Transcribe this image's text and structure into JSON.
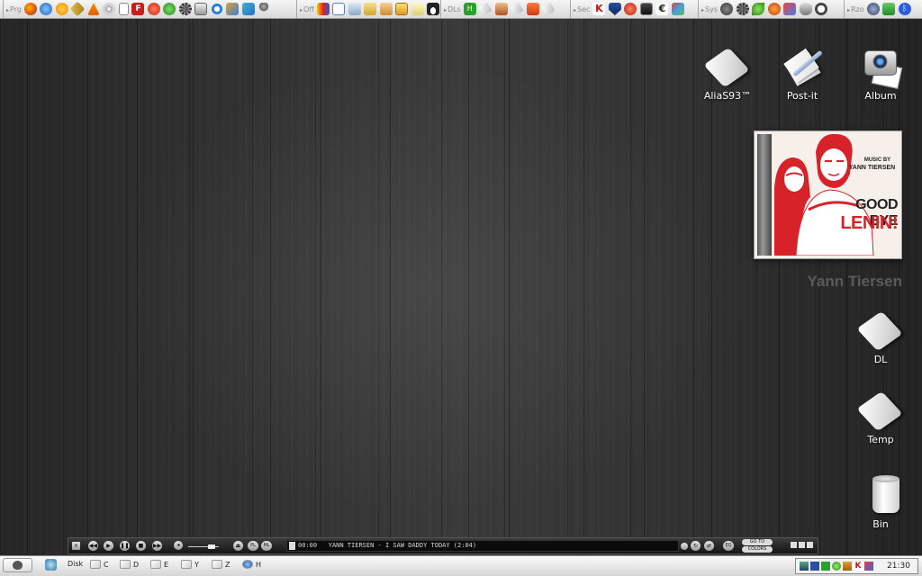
{
  "toolbar": {
    "groups": [
      {
        "label": "Prg",
        "icons": [
          "firefox-icon",
          "globe-icon",
          "media-player-icon",
          "ftp-icon",
          "vlc-icon",
          "disc-icon",
          "document-icon",
          "filezilla-icon",
          "red-app-icon",
          "green-plus-icon",
          "gear-icon",
          "calculator-icon",
          "refresh-icon",
          "network-icon",
          "puzzle-icon",
          "pin-icon"
        ]
      },
      {
        "label": "Off",
        "icons": [
          "colors-icon",
          "edit-icon",
          "document-icon",
          "folder-icon",
          "folder-icon",
          "photo-icon",
          "note-icon",
          "tux-icon"
        ]
      },
      {
        "label": "DLs",
        "icons": [
          "download-icon",
          "tile-icon",
          "pdf-icon",
          "tile-icon",
          "acrobat-icon",
          "tile-icon"
        ]
      },
      {
        "label": "Sec",
        "icons": [
          "k-icon",
          "shield-icon",
          "lock-icon",
          "vault-icon",
          "euro-icon",
          "vpn-shield-icon"
        ]
      },
      {
        "label": "Sys",
        "icons": [
          "wrench-icon",
          "gear-icon",
          "leaf-icon",
          "cpu-icon",
          "tools-icon",
          "drive-icon",
          "clock-icon"
        ]
      },
      {
        "label": "Rzo",
        "icons": [
          "network-icon",
          "antenna-icon",
          "bluetooth-icon"
        ]
      }
    ]
  },
  "desktop": {
    "icons": [
      {
        "label": "AliaS93™",
        "icon": "drive-tile-icon"
      },
      {
        "label": "Post-it",
        "icon": "notes-pen-icon"
      },
      {
        "label": "Album",
        "icon": "camera-photos-icon"
      },
      {
        "label": "DL",
        "icon": "drive-tile-icon"
      },
      {
        "label": "Temp",
        "icon": "drive-tile-icon"
      },
      {
        "label": "Bin",
        "icon": "trash-bin-icon"
      }
    ]
  },
  "now_playing": {
    "artist": "Yann Tiersen",
    "cover": {
      "line1": "MUSIC BY",
      "line2": "YANN TIERSEN",
      "title1": "GOOD BYE",
      "title2": "LENIN!"
    }
  },
  "player": {
    "time": "00:00",
    "track": "YANN TIERSEN - I SAW DADDY TODAY (2:04)",
    "pl_label": "PL",
    "ml_label": "ML",
    "eq_label": "EQ",
    "buttons_label_1": "GO TO",
    "buttons_label_2": "COLORS"
  },
  "taskbar": {
    "disk_label": "Disk",
    "drives": [
      "C",
      "D",
      "E",
      "Y",
      "Z",
      "H"
    ],
    "clock": "21:30"
  },
  "colors": {
    "cover_red": "#d8222a",
    "artist_text": "#5b5b5b"
  }
}
